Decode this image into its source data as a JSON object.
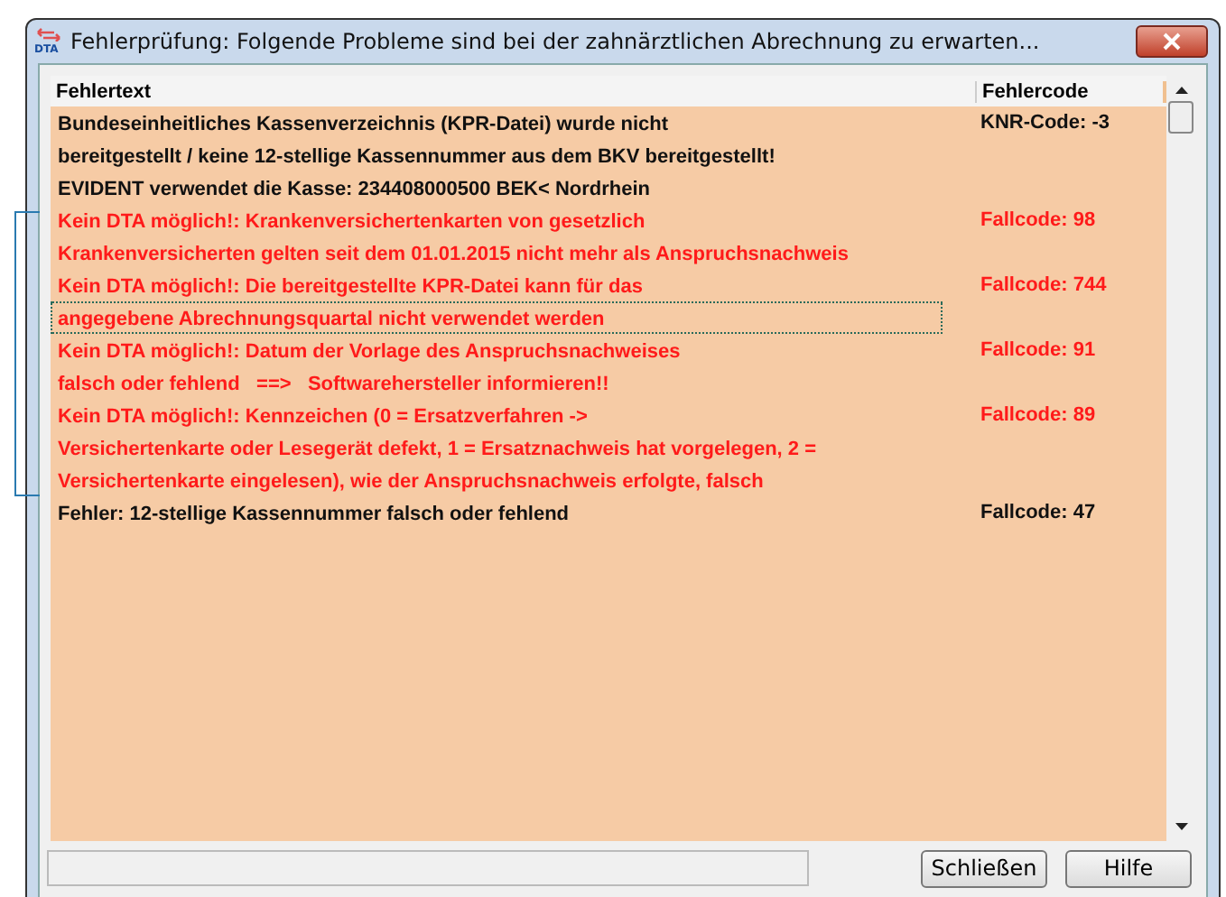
{
  "window": {
    "title": "Fehlerprüfung: Folgende Probleme sind bei der zahnärztlichen Abrechnung zu erwarten...",
    "app_badge": "DTA"
  },
  "table": {
    "columns": [
      "Fehlertext",
      "Fehlercode"
    ],
    "rows": [
      {
        "kind": "info",
        "code": "KNR-Code: -3",
        "lines": [
          {
            "text": "Bundeseinheitliches Kassenverzeichnis (KPR-Datei) wurde nicht",
            "focused": false
          },
          {
            "text": "bereitgestellt / keine 12-stellige Kassennummer aus dem BKV bereitgestellt!",
            "focused": false
          },
          {
            "text": "EVIDENT verwendet die Kasse: 234408000500 BEK< Nordrhein",
            "focused": false
          }
        ]
      },
      {
        "kind": "error",
        "code": "Fallcode: 98",
        "lines": [
          {
            "text": "Kein DTA möglich!: Krankenversichertenkarten von gesetzlich",
            "focused": false
          },
          {
            "text": "Krankenversicherten gelten seit dem 01.01.2015 nicht mehr als Anspruchsnachweis",
            "focused": false
          }
        ]
      },
      {
        "kind": "error",
        "code": "Fallcode: 744",
        "lines": [
          {
            "text": "Kein DTA möglich!: Die bereitgestellte KPR-Datei kann für das",
            "focused": false
          },
          {
            "text": "angegebene Abrechnungsquartal nicht verwendet werden",
            "focused": true
          }
        ]
      },
      {
        "kind": "error",
        "code": "Fallcode: 91",
        "lines": [
          {
            "text": "Kein DTA möglich!: Datum der Vorlage des Anspruchsnachweises",
            "focused": false
          },
          {
            "text": "falsch oder fehlend   ==>   Softwarehersteller informieren!!",
            "focused": false
          }
        ]
      },
      {
        "kind": "error",
        "code": "Fallcode: 89",
        "lines": [
          {
            "text": "Kein DTA möglich!: Kennzeichen (0 = Ersatzverfahren ->",
            "focused": false
          },
          {
            "text": "Versichertenkarte oder Lesegerät defekt, 1 = Ersatznachweis hat vorgelegen, 2 =",
            "focused": false
          },
          {
            "text": "Versichertenkarte eingelesen), wie der Anspruchsnachweis erfolgte, falsch",
            "focused": false
          }
        ]
      },
      {
        "kind": "info",
        "code": "Fallcode: 47",
        "lines": [
          {
            "text": "Fehler: 12-stellige Kassennummer falsch oder fehlend",
            "focused": false
          }
        ]
      }
    ]
  },
  "buttons": [
    "Schließen",
    "Hilfe"
  ]
}
